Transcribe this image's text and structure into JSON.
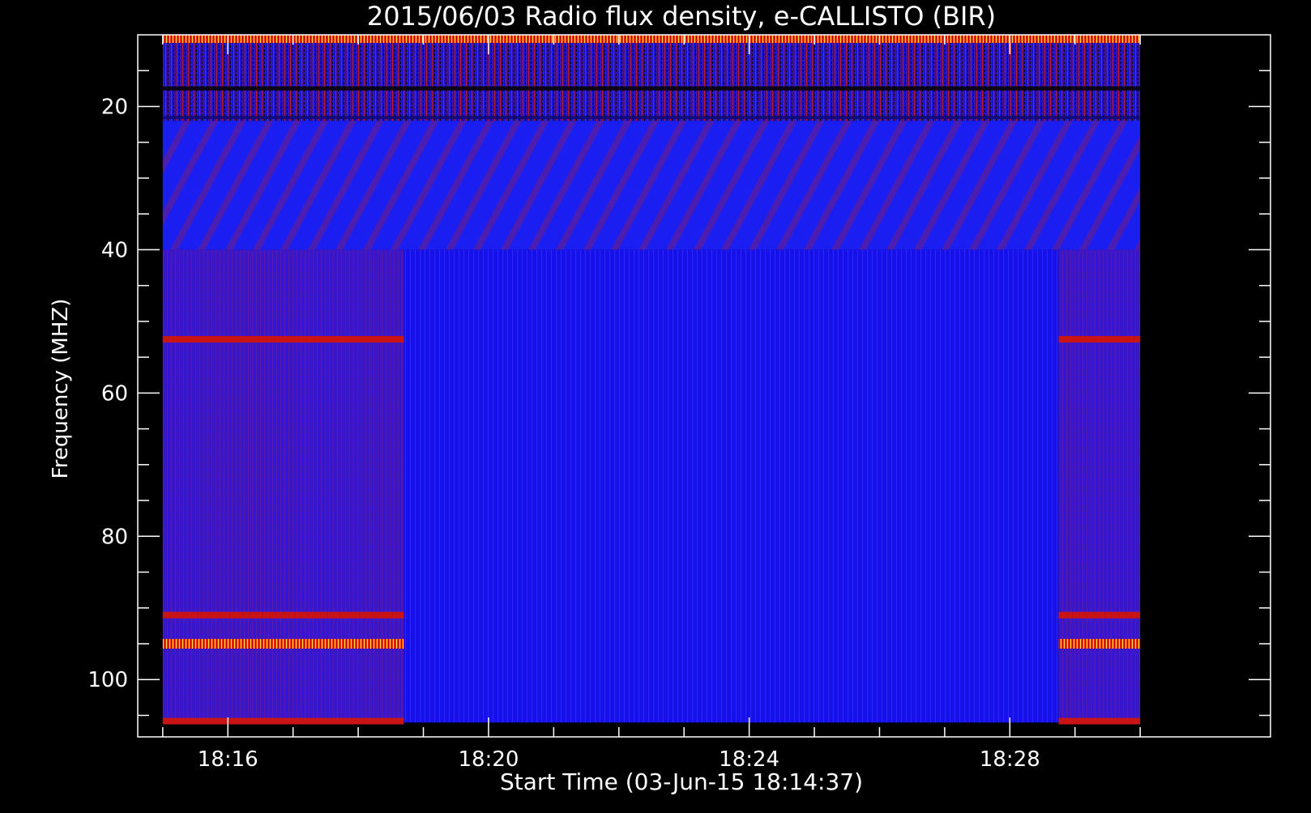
{
  "chart_data": {
    "type": "heatmap",
    "title": "2015/06/03  Radio flux density, e-CALLISTO (BIR)",
    "xlabel": "Start Time (03-Jun-15 18:14:37)",
    "ylabel": "Frequency (MHZ)",
    "y_axis_inverted": true,
    "xlim": [
      "18:14:37",
      "18:32:00"
    ],
    "ylim": [
      10,
      108
    ],
    "data_time_range": [
      "18:15:00",
      "18:30:00"
    ],
    "data_freq_range": [
      10,
      106
    ],
    "x_ticks": [
      "18:16",
      "18:20",
      "18:24",
      "18:28"
    ],
    "y_ticks": [
      20,
      40,
      60,
      80,
      100
    ],
    "grid": false,
    "colormap": [
      "#000000",
      "#0000ff",
      "#ff0000",
      "#ffff00"
    ],
    "regions": [
      {
        "name": "rfi-top",
        "time": [
          "18:15:00",
          "18:30:00"
        ],
        "freq": [
          10,
          22
        ],
        "intensity": "high, mixed"
      },
      {
        "name": "diagonal-stripes",
        "time": [
          "18:15:00",
          "18:30:00"
        ],
        "freq": [
          22,
          40
        ],
        "intensity": "low"
      },
      {
        "name": "background",
        "time": [
          "18:18:42",
          "18:28:45"
        ],
        "freq": [
          40,
          106
        ],
        "intensity": "low"
      },
      {
        "name": "band-segment-left",
        "time": [
          "18:15:00",
          "18:18:42"
        ],
        "freq": [
          40,
          106
        ],
        "intensity": "medium"
      },
      {
        "name": "band-segment-right",
        "time": [
          "18:28:45",
          "18:30:00"
        ],
        "freq": [
          40,
          106
        ],
        "intensity": "medium"
      }
    ],
    "bands": [
      {
        "freq": 52.5,
        "intensity": "high"
      },
      {
        "freq": 91.0,
        "intensity": "high"
      },
      {
        "freq": 95.0,
        "intensity": "very high"
      },
      {
        "freq": 105.8,
        "intensity": "high"
      }
    ]
  }
}
